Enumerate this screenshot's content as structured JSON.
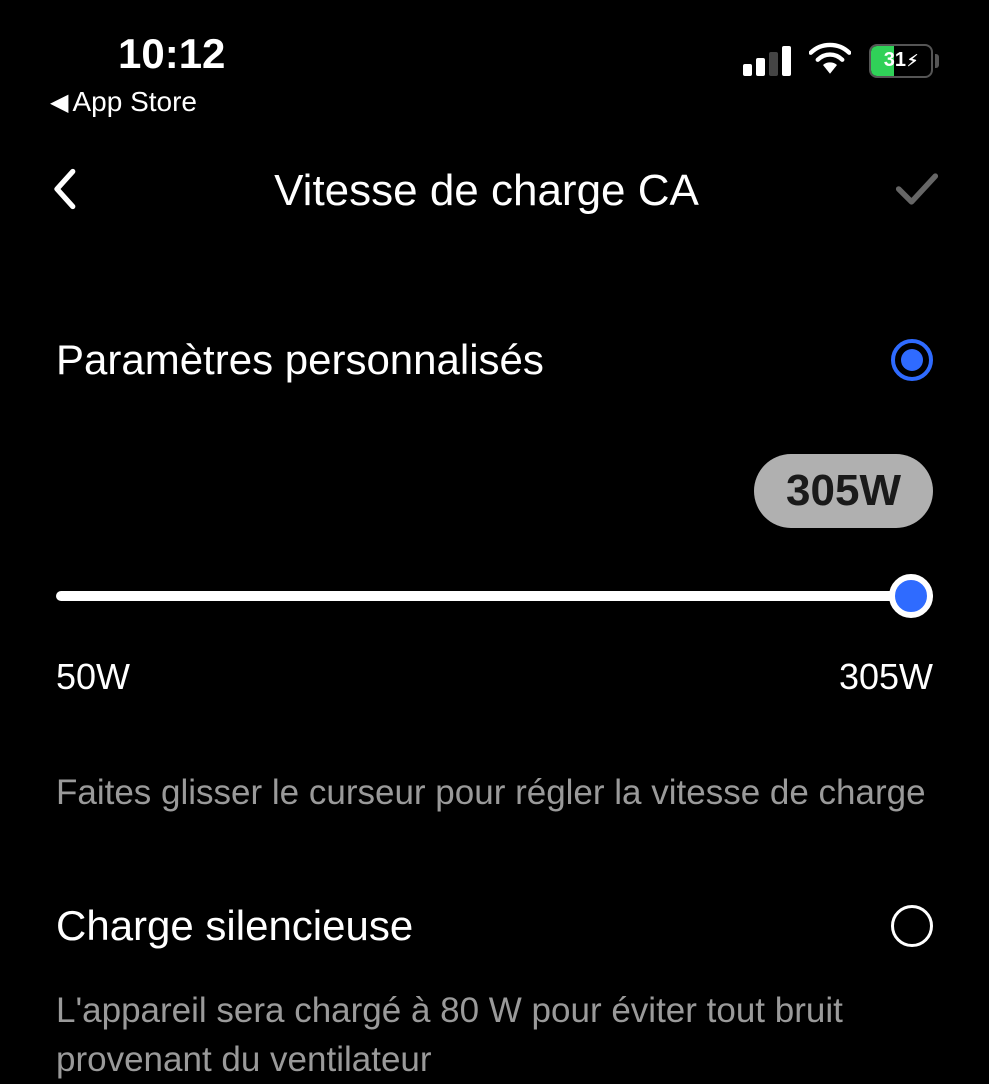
{
  "status": {
    "time": "10:12",
    "back_app_label": "App Store",
    "battery_percent": "31"
  },
  "nav": {
    "title": "Vitesse de charge CA"
  },
  "custom": {
    "label": "Paramètres personnalisés",
    "current_value": "305W",
    "min_label": "50W",
    "max_label": "305W",
    "hint": "Faites glisser le curseur pour régler la vitesse de charge"
  },
  "silent": {
    "label": "Charge silencieuse",
    "desc": "L'appareil sera chargé à 80 W pour éviter tout bruit provenant du ventilateur"
  }
}
